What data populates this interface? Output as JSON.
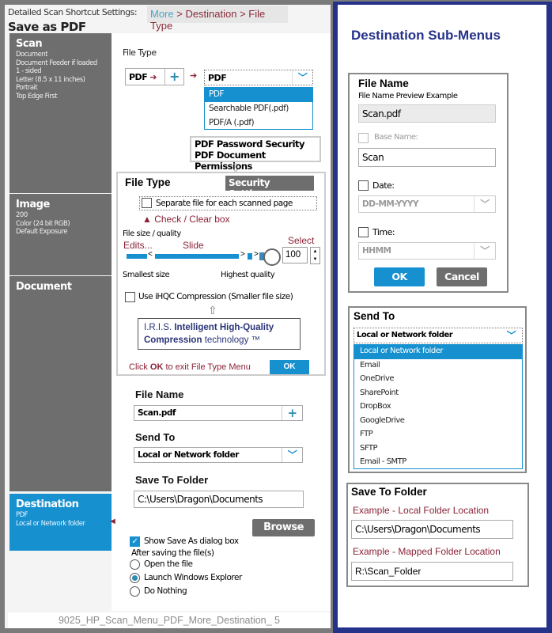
{
  "header": {
    "caption": "Detailed Scan Shortcut Settings:",
    "breadcrumb_more": "More",
    "breadcrumb_rest": " > Destination > File Type",
    "title": "Save as PDF"
  },
  "sidebar": {
    "scan": {
      "title": "Scan",
      "lines": [
        "Document",
        "Document Feeder if loaded",
        "1 - sided",
        "Letter (8.5 x 11 inches)",
        "Portrait",
        "Top Edge First"
      ]
    },
    "image": {
      "title": "Image",
      "lines": [
        "200",
        "Color (24 bit RGB)",
        "Default Exposure"
      ]
    },
    "document": {
      "title": "Document"
    },
    "destination": {
      "title": "Destination",
      "lines": [
        "PDF",
        "Local or Network folder"
      ]
    }
  },
  "file_type": {
    "label": "File Type",
    "chip": "PDF",
    "selected": "PDF",
    "options": [
      "PDF",
      "Searchable PDF(.pdf)",
      "PDF/A (.pdf)"
    ]
  },
  "security_callout": {
    "line1": "PDF Password Security",
    "line2": "PDF Document Permissions"
  },
  "file_type_panel": {
    "title": "File Type",
    "security_button": "Security Settings",
    "separate_file": "Separate file for each scanned page",
    "check_hint": "Check / Clear box",
    "size_quality_label": "File size / quality",
    "edits_hint": "Edits...",
    "slide_hint": "Slide",
    "select_hint": "Select",
    "quality_value": "100",
    "quality_percent": 100,
    "smallest": "Smallest size",
    "highest": "Highest quality",
    "ihqc": "Use iHQC Compression (Smaller file size)",
    "iris_prefix": "I.R.I.S. ",
    "iris_bold": "Intelligent High-Quality Compression",
    "iris_suffix": " technology ™",
    "ok_hint_pre": "Click ",
    "ok_hint_bold": "OK",
    "ok_hint_post": " to exit File Type Menu",
    "ok_button": "OK"
  },
  "destination": {
    "file_name_label": "File Name",
    "file_name_value": "Scan.pdf",
    "send_to_label": "Send To",
    "send_to_value": "Local or Network folder",
    "save_to_label": "Save To Folder",
    "save_to_value": "C:\\Users\\Dragon\\Documents",
    "browse": "Browse",
    "show_save_as": "Show Save As dialog box",
    "after_saving": "After saving the file(s)",
    "radios": [
      {
        "label": "Open the file",
        "checked": false
      },
      {
        "label": "Launch Windows Explorer",
        "checked": true
      },
      {
        "label": "Do Nothing",
        "checked": false
      }
    ]
  },
  "footer": "9025_HP_Scan_Menu_PDF_More_Destination_ 5",
  "submenus": {
    "title": "Destination Sub-Menus",
    "file_name": {
      "title": "File Name",
      "preview_label": "File Name Preview Example",
      "preview": "Scan.pdf",
      "base_name_label": "Base Name:",
      "base_name_value": "Scan",
      "date_label": "Date:",
      "date_value": "DD-MM-YYYY",
      "time_label": "Time:",
      "time_value": "HHMM",
      "ok": "OK",
      "cancel": "Cancel"
    },
    "send_to": {
      "title": "Send To",
      "selected": "Local or Network folder",
      "options": [
        "Local or Network folder",
        "Email",
        "OneDrive",
        "SharePoint",
        "DropBox",
        "GoogleDrive",
        "FTP",
        "SFTP",
        "Email - SMTP"
      ]
    },
    "save_to_folder": {
      "title": "Save To Folder",
      "local_label": "Example - Local Folder Location",
      "local_value": "C:\\Users\\Dragon\\Documents",
      "mapped_label": "Example - Mapped Folder Location",
      "mapped_value": "R:\\Scan_Folder"
    }
  },
  "colors": {
    "accent": "#1690cf",
    "sidebar": "#6e6e6e",
    "frame": "#25328a",
    "hint": "#8a2236"
  }
}
